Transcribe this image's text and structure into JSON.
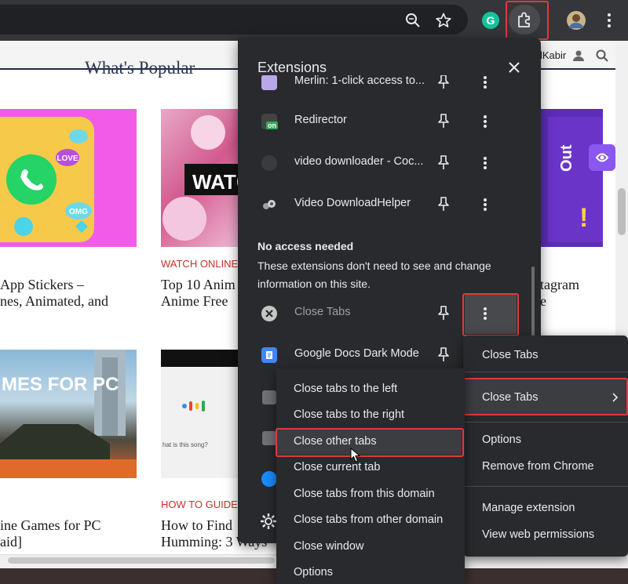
{
  "browser": {
    "toolbar_icons": [
      "zoom-icon",
      "star-icon",
      "grammarly-icon",
      "extensions-puzzle-icon",
      "profile-avatar",
      "menu-kebab-icon"
    ]
  },
  "site": {
    "section_title": "What's Popular",
    "author": "lKabir",
    "cards_row1": [
      {
        "category": "",
        "title_line1": "App Stickers –",
        "title_line2": "nes, Animated, and"
      },
      {
        "category": "WATCH ONLINE",
        "title_line1": "Top 10 Anim",
        "title_line2": "Anime Free"
      },
      {
        "category": "",
        "title_line1": "tagram",
        "title_line2": "e"
      }
    ],
    "cards_row2": [
      {
        "category": "",
        "title_line1": "ine Games for PC",
        "title_line2": "aid]"
      },
      {
        "category": "HOW TO GUIDE",
        "title_line1": "How to Find",
        "title_line2": "Humming: 3 Ways"
      }
    ],
    "thumb_texts": {
      "watch": "WATCH",
      "games": "MES FOR PC",
      "out": "Out",
      "song": "hat is this song?"
    }
  },
  "extensions_popup": {
    "title": "Extensions",
    "items": [
      {
        "name": "Merlin: 1-click access to...",
        "icon": "merlin-icon",
        "dim": false
      },
      {
        "name": "Redirector",
        "icon": "redirector-icon",
        "badge": "on",
        "dim": false
      },
      {
        "name": "video downloader - Coc...",
        "icon": "video-downloader-icon",
        "dim": false
      },
      {
        "name": "Video DownloadHelper",
        "icon": "video-downloadhelper-icon",
        "dim": false
      }
    ],
    "no_access_title": "No access needed",
    "no_access_desc": "These extensions don't need to see and change information on this site.",
    "no_access_items": [
      {
        "name": "Close Tabs",
        "icon": "close-tabs-icon",
        "dim": true
      },
      {
        "name": "Google Docs Dark Mode",
        "icon": "google-docs-icon",
        "dim": false
      }
    ]
  },
  "context_menu": {
    "items": [
      "Close Tabs",
      "Close Tabs",
      "Options",
      "Remove from Chrome",
      "Manage extension",
      "View web permissions"
    ],
    "submenu_item_index": 1
  },
  "submenu": {
    "items": [
      "Close tabs to the left",
      "Close tabs to the right",
      "Close other tabs",
      "Close current tab",
      "Close tabs from this domain",
      "Close tabs from other domain",
      "Close window",
      "Options"
    ],
    "highlighted_index": 2
  },
  "colors": {
    "popup_bg": "#292a2d",
    "highlight_red": "#e03a3a",
    "site_category": "#c9302c"
  }
}
